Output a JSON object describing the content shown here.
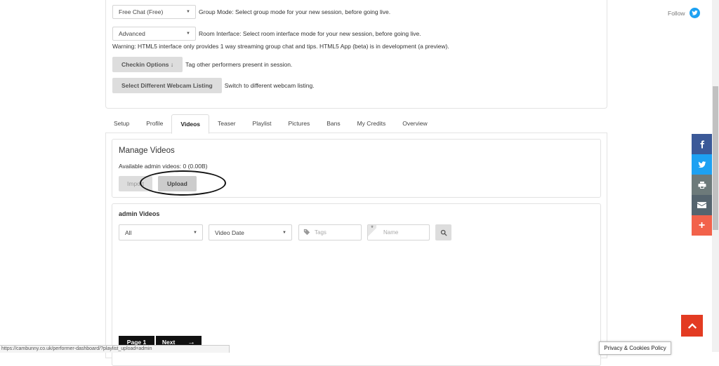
{
  "top": {
    "group_mode": {
      "value": "Free Chat (Free)",
      "desc": "Group Mode: Select group mode for your new session, before going live."
    },
    "room_interface": {
      "value": "Advanced",
      "desc": "Room Interface: Select room interface mode for your new session, before going live."
    },
    "warning": "Warning: HTML5 interface only provides 1 way streaming group chat and tips. HTML5 App (beta) is in development (a preview).",
    "checkin": {
      "label": "Checkin Options ↓",
      "desc": "Tag other performers present in session."
    },
    "webcam": {
      "label": "Select Different Webcam Listing",
      "desc": "Switch to different webcam listing."
    }
  },
  "follow": {
    "label": "Follow"
  },
  "tabs": [
    "Setup",
    "Profile",
    "Videos",
    "Teaser",
    "Playlist",
    "Pictures",
    "Bans",
    "My Credits",
    "Overview"
  ],
  "manage": {
    "title": "Manage Videos",
    "available": "Available admin videos: 0 (0.00B)",
    "import_label": "Import",
    "upload_label": "Upload"
  },
  "admin_videos": {
    "title": "admin Videos",
    "filter_all": "All",
    "sort": "Video Date",
    "tags_placeholder": "Tags",
    "name_placeholder": "Name"
  },
  "pager": {
    "page": "Page 1",
    "next": "Next"
  },
  "status_url": "https://cambunny.co.uk/performer-dashboard/?playlist_upload=admin",
  "privacy": "Privacy & Cookies Policy",
  "colors": {
    "facebook": "#3b5998",
    "twitter": "#1da1f2",
    "print": "#6d7a7a",
    "email": "#55646e",
    "plus": "#f2624b",
    "scroll_top": "#e33b22"
  },
  "icons": [
    "twitter-icon",
    "facebook-icon",
    "print-icon",
    "email-icon",
    "plus-icon",
    "tag-icon",
    "search-icon",
    "chevron-up-icon"
  ]
}
